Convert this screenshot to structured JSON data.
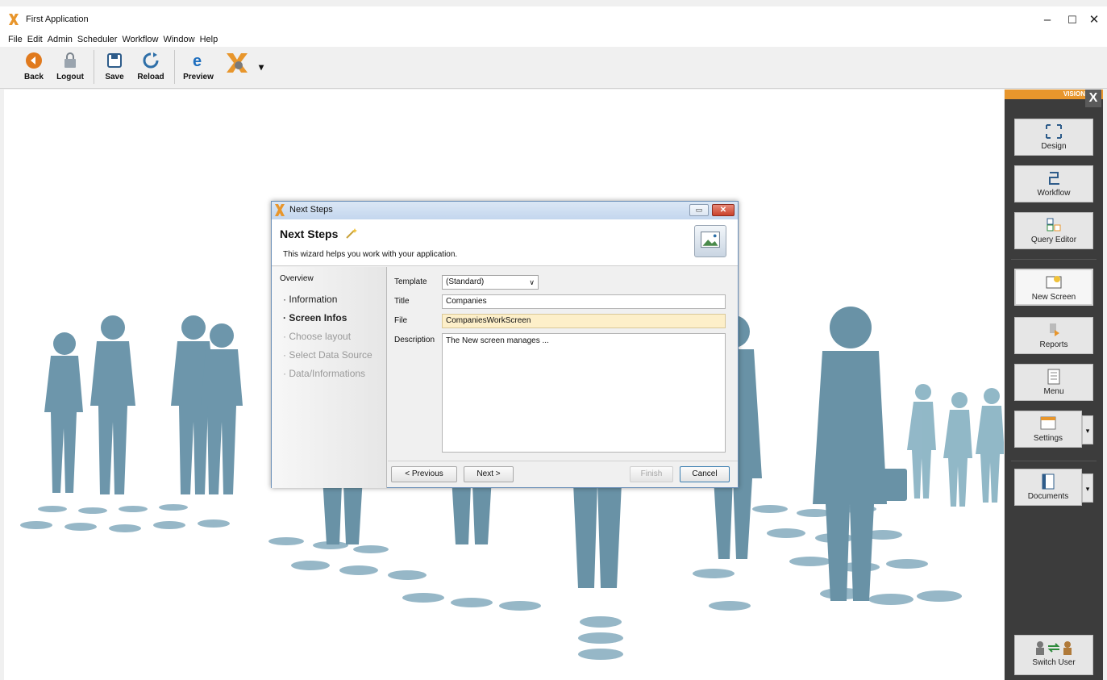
{
  "window": {
    "title": "First Application",
    "minimize": "–",
    "maximize": "☐",
    "close": "✕"
  },
  "menu": [
    "File",
    "Edit",
    "Admin",
    "Scheduler",
    "Workflow",
    "Window",
    "Help"
  ],
  "toolbar": {
    "back": "Back",
    "logout": "Logout",
    "save": "Save",
    "reload": "Reload",
    "preview": "Preview",
    "dropdown": "▾"
  },
  "panel": {
    "brand": "VISION",
    "logo": "X",
    "design": "Design",
    "workflow": "Workflow",
    "query_editor": "Query Editor",
    "new_screen": "New Screen",
    "reports": "Reports",
    "menu": "Menu",
    "settings": "Settings",
    "documents": "Documents",
    "switch_user": "Switch User",
    "dropdown": "▾"
  },
  "dialog": {
    "title": "Next Steps",
    "heading": "Next Steps",
    "subtitle": "This wizard helps you work with your application.",
    "minimize": "▭",
    "close": "✕",
    "nav": {
      "overview": "Overview",
      "items": [
        {
          "label": "Information",
          "state": "normal"
        },
        {
          "label": "Screen Infos",
          "state": "current"
        },
        {
          "label": "Choose layout",
          "state": "disabled"
        },
        {
          "label": "Select Data Source",
          "state": "disabled"
        },
        {
          "label": "Data/Informations",
          "state": "disabled"
        }
      ]
    },
    "form": {
      "template_label": "Template",
      "template_value": "(Standard)",
      "title_label": "Title",
      "title_value": "Companies",
      "file_label": "File",
      "file_value": "CompaniesWorkScreen",
      "description_label": "Description",
      "description_value": "The New screen manages ..."
    },
    "buttons": {
      "previous": "< Previous",
      "next": "Next >",
      "finish": "Finish",
      "cancel": "Cancel"
    }
  },
  "colors": {
    "accent_orange": "#e8962c",
    "silhouette": "#1f5f7f",
    "panel_bg": "#3c3c3c",
    "file_highlight": "#fdefc9"
  }
}
